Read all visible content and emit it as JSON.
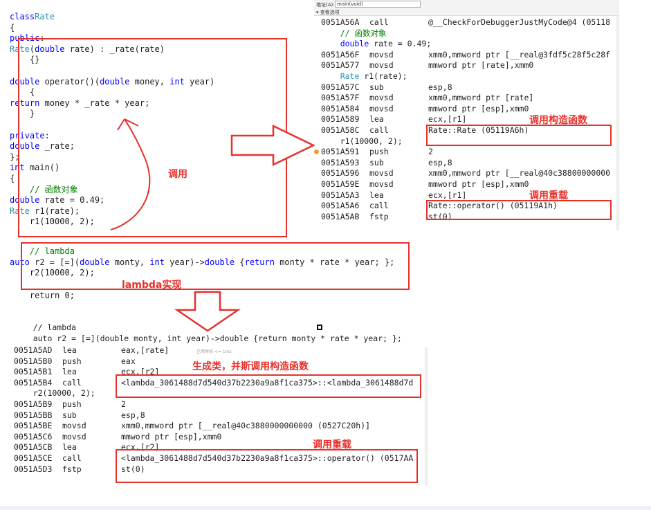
{
  "top_left": {
    "lines": [
      "class Rate",
      "{",
      "public:",
      "    Rate(double rate) : _rate(rate)",
      "    {}",
      "",
      "    double operator()(double money, int year)",
      "    {",
      "        return money * _rate * year;",
      "    }",
      "",
      "private:",
      "    double _rate;",
      "};",
      "int main()",
      "{",
      "    // 函数对象",
      "    double rate = 0.49;",
      "    Rate r1(rate);",
      "    r1(10000, 2);"
    ],
    "lambda_lines": [
      "    // lambda",
      "    auto r2 = [=](double monty, int year)->double {return monty * rate * year; };",
      "    r2(10000, 2);"
    ],
    "return_line": "    return 0;"
  },
  "top_right": {
    "toolbar_label": "地址(A):",
    "toolbar_value": "main(void)",
    "toolbar_option": "▾ 查看选项",
    "lines": [
      {
        "addr": "0051A56A",
        "op": "call",
        "arg": "@__CheckForDebuggerJustMyCode@4 (05118"
      },
      {
        "src": "    // 函数对象"
      },
      {
        "src": "    double rate = 0.49;"
      },
      {
        "addr": "0051A56F",
        "op": "movsd",
        "arg": "xmm0,mmword ptr [__real@3fdf5c28f5c28f"
      },
      {
        "addr": "0051A577",
        "op": "movsd",
        "arg": "mmword ptr [rate],xmm0"
      },
      {
        "src": "    Rate r1(rate);"
      },
      {
        "addr": "0051A57C",
        "op": "sub",
        "arg": "esp,8"
      },
      {
        "addr": "0051A57F",
        "op": "movsd",
        "arg": "xmm0,mmword ptr [rate]"
      },
      {
        "addr": "0051A584",
        "op": "movsd",
        "arg": "mmword ptr [esp],xmm0"
      },
      {
        "addr": "0051A589",
        "op": "lea",
        "arg": "ecx,[r1]"
      },
      {
        "addr": "0051A58C",
        "op": "call",
        "arg": "Rate::Rate (05119A6h)"
      },
      {
        "src": "    r1(10000, 2);"
      },
      {
        "addr": "0051A591",
        "op": "push",
        "arg": "2"
      },
      {
        "addr": "0051A593",
        "op": "sub",
        "arg": "esp,8"
      },
      {
        "addr": "0051A596",
        "op": "movsd",
        "arg": "xmm0,mmword ptr [__real@40c38800000000"
      },
      {
        "addr": "0051A59E",
        "op": "movsd",
        "arg": "mmword ptr [esp],xmm0"
      },
      {
        "addr": "0051A5A3",
        "op": "lea",
        "arg": "ecx,[r1]"
      },
      {
        "addr": "0051A5A6",
        "op": "call",
        "arg": "Rate::operator() (05119A1h)"
      },
      {
        "addr": "0051A5AB",
        "op": "fstp",
        "arg": "st(0)"
      }
    ]
  },
  "bottom": {
    "src_lines": [
      "    // lambda",
      "    auto r2 = [=](double monty, int year)->double {return monty * rate * year; };"
    ],
    "hint": "已用时间 <= 1ms",
    "lines": [
      {
        "addr": "0051A5AD",
        "op": "lea",
        "arg": "eax,[rate]"
      },
      {
        "addr": "0051A5B0",
        "op": "push",
        "arg": "eax"
      },
      {
        "addr": "0051A5B1",
        "op": "lea",
        "arg": "ecx,[r2]"
      },
      {
        "addr": "0051A5B4",
        "op": "call",
        "arg": "<lambda_3061488d7d540d37b2230a9a8f1ca375>::<lambda_3061488d7d"
      },
      {
        "src": "    r2(10000, 2);"
      },
      {
        "addr": "0051A5B9",
        "op": "push",
        "arg": "2"
      },
      {
        "addr": "0051A5BB",
        "op": "sub",
        "arg": "esp,8"
      },
      {
        "addr": "0051A5BE",
        "op": "movsd",
        "arg": "xmm0,mmword ptr [__real@40c3880000000000 (0527C20h)]"
      },
      {
        "addr": "0051A5C6",
        "op": "movsd",
        "arg": "mmword ptr [esp],xmm0"
      },
      {
        "addr": "0051A5CB",
        "op": "lea",
        "arg": "ecx,[r2]"
      },
      {
        "addr": "0051A5CE",
        "op": "call",
        "arg": "<lambda_3061488d7d540d37b2230a9a8f1ca375>::operator() (0517AA"
      },
      {
        "addr": "0051A5D3",
        "op": "fstp",
        "arg": "st(0)"
      }
    ]
  },
  "annotations": {
    "call_label": "调用",
    "ctor_label": "调用构造函数",
    "overload_label": "调用重载",
    "lambda_impl_label": "lambda实现",
    "gen_class_label": "生成类，并斯调用构造函数",
    "overload_label_bottom": "调用重载"
  },
  "colors": {
    "annotation": "#e8302b",
    "keyword": "#0000ff",
    "type": "#2b91af",
    "comment": "#008000"
  }
}
